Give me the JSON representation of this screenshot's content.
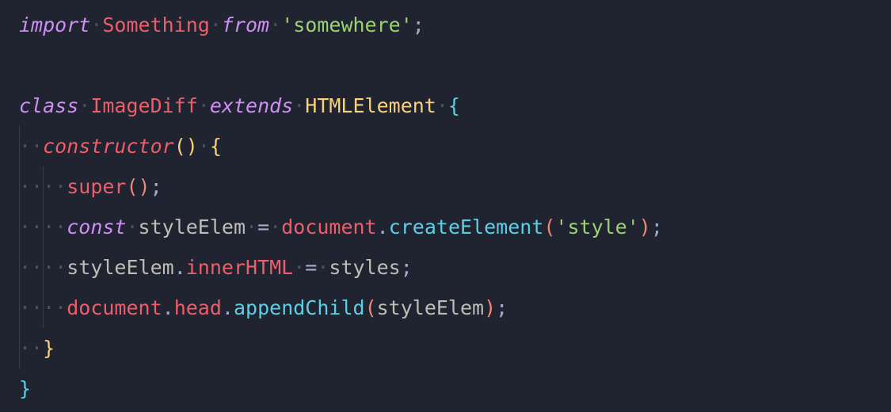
{
  "colors": {
    "background": "#1f2430",
    "guide": "#4a5260",
    "whitespace": "#4a5260",
    "keyword": "#cf8ef4",
    "classname": "#ed5e6a",
    "type": "#fad07b",
    "string": "#9dd274",
    "punct": "#a6accd",
    "brace_teal": "#5ccfe6",
    "brace_yellow": "#fad07b",
    "paren_pink": "#f28779",
    "method": "#5ccfe6",
    "ident": "#bfbdb6"
  },
  "code": {
    "lines": [
      {
        "indent": 0,
        "tokens": [
          {
            "t": "import",
            "c": "keyword-italic"
          },
          {
            "t": " ",
            "c": "ws"
          },
          {
            "t": "Something",
            "c": "classname"
          },
          {
            "t": " ",
            "c": "ws"
          },
          {
            "t": "from",
            "c": "keyword-italic"
          },
          {
            "t": " ",
            "c": "ws"
          },
          {
            "t": "'somewhere'",
            "c": "string"
          },
          {
            "t": ";",
            "c": "punct"
          }
        ]
      },
      {
        "indent": 0,
        "blank": true,
        "tokens": []
      },
      {
        "indent": 0,
        "tokens": [
          {
            "t": "class",
            "c": "keyword-italic"
          },
          {
            "t": " ",
            "c": "ws"
          },
          {
            "t": "ImageDiff",
            "c": "classname"
          },
          {
            "t": " ",
            "c": "ws"
          },
          {
            "t": "extends",
            "c": "keyword-italic"
          },
          {
            "t": " ",
            "c": "ws"
          },
          {
            "t": "HTMLElement",
            "c": "type"
          },
          {
            "t": " ",
            "c": "ws"
          },
          {
            "t": "{",
            "c": "brace-teal"
          }
        ]
      },
      {
        "indent": 2,
        "guides": [
          1
        ],
        "tokens": [
          {
            "t": "constructor",
            "c": "ctor"
          },
          {
            "t": "(",
            "c": "brace-yellow"
          },
          {
            "t": ")",
            "c": "brace-yellow"
          },
          {
            "t": " ",
            "c": "ws"
          },
          {
            "t": "{",
            "c": "brace-yellow"
          }
        ]
      },
      {
        "indent": 4,
        "guides": [
          1,
          2
        ],
        "tokens": [
          {
            "t": "super",
            "c": "super"
          },
          {
            "t": "(",
            "c": "paren-pink"
          },
          {
            "t": ")",
            "c": "paren-pink"
          },
          {
            "t": ";",
            "c": "punct"
          }
        ]
      },
      {
        "indent": 4,
        "guides": [
          1,
          2
        ],
        "tokens": [
          {
            "t": "const",
            "c": "keyword-italic"
          },
          {
            "t": " ",
            "c": "ws"
          },
          {
            "t": "styleElem",
            "c": "ident"
          },
          {
            "t": " ",
            "c": "ws"
          },
          {
            "t": "=",
            "c": "operator"
          },
          {
            "t": " ",
            "c": "ws"
          },
          {
            "t": "document",
            "c": "prop-red"
          },
          {
            "t": ".",
            "c": "punct"
          },
          {
            "t": "createElement",
            "c": "method"
          },
          {
            "t": "(",
            "c": "paren-pink"
          },
          {
            "t": "'style'",
            "c": "string"
          },
          {
            "t": ")",
            "c": "paren-pink"
          },
          {
            "t": ";",
            "c": "punct"
          }
        ]
      },
      {
        "indent": 4,
        "guides": [
          1,
          2
        ],
        "tokens": [
          {
            "t": "styleElem",
            "c": "ident"
          },
          {
            "t": ".",
            "c": "punct"
          },
          {
            "t": "innerHTML",
            "c": "prop-red"
          },
          {
            "t": " ",
            "c": "ws"
          },
          {
            "t": "=",
            "c": "operator"
          },
          {
            "t": " ",
            "c": "ws"
          },
          {
            "t": "styles",
            "c": "ident"
          },
          {
            "t": ";",
            "c": "punct"
          }
        ]
      },
      {
        "indent": 4,
        "guides": [
          1,
          2
        ],
        "tokens": [
          {
            "t": "document",
            "c": "prop-red"
          },
          {
            "t": ".",
            "c": "punct"
          },
          {
            "t": "head",
            "c": "prop-red"
          },
          {
            "t": ".",
            "c": "punct"
          },
          {
            "t": "appendChild",
            "c": "method"
          },
          {
            "t": "(",
            "c": "paren-pink"
          },
          {
            "t": "styleElem",
            "c": "ident"
          },
          {
            "t": ")",
            "c": "paren-pink"
          },
          {
            "t": ";",
            "c": "punct"
          }
        ]
      },
      {
        "indent": 2,
        "guides": [
          1
        ],
        "tokens": [
          {
            "t": "}",
            "c": "brace-yellow"
          }
        ]
      },
      {
        "indent": 0,
        "tokens": [
          {
            "t": "}",
            "c": "brace-teal"
          }
        ]
      }
    ]
  }
}
